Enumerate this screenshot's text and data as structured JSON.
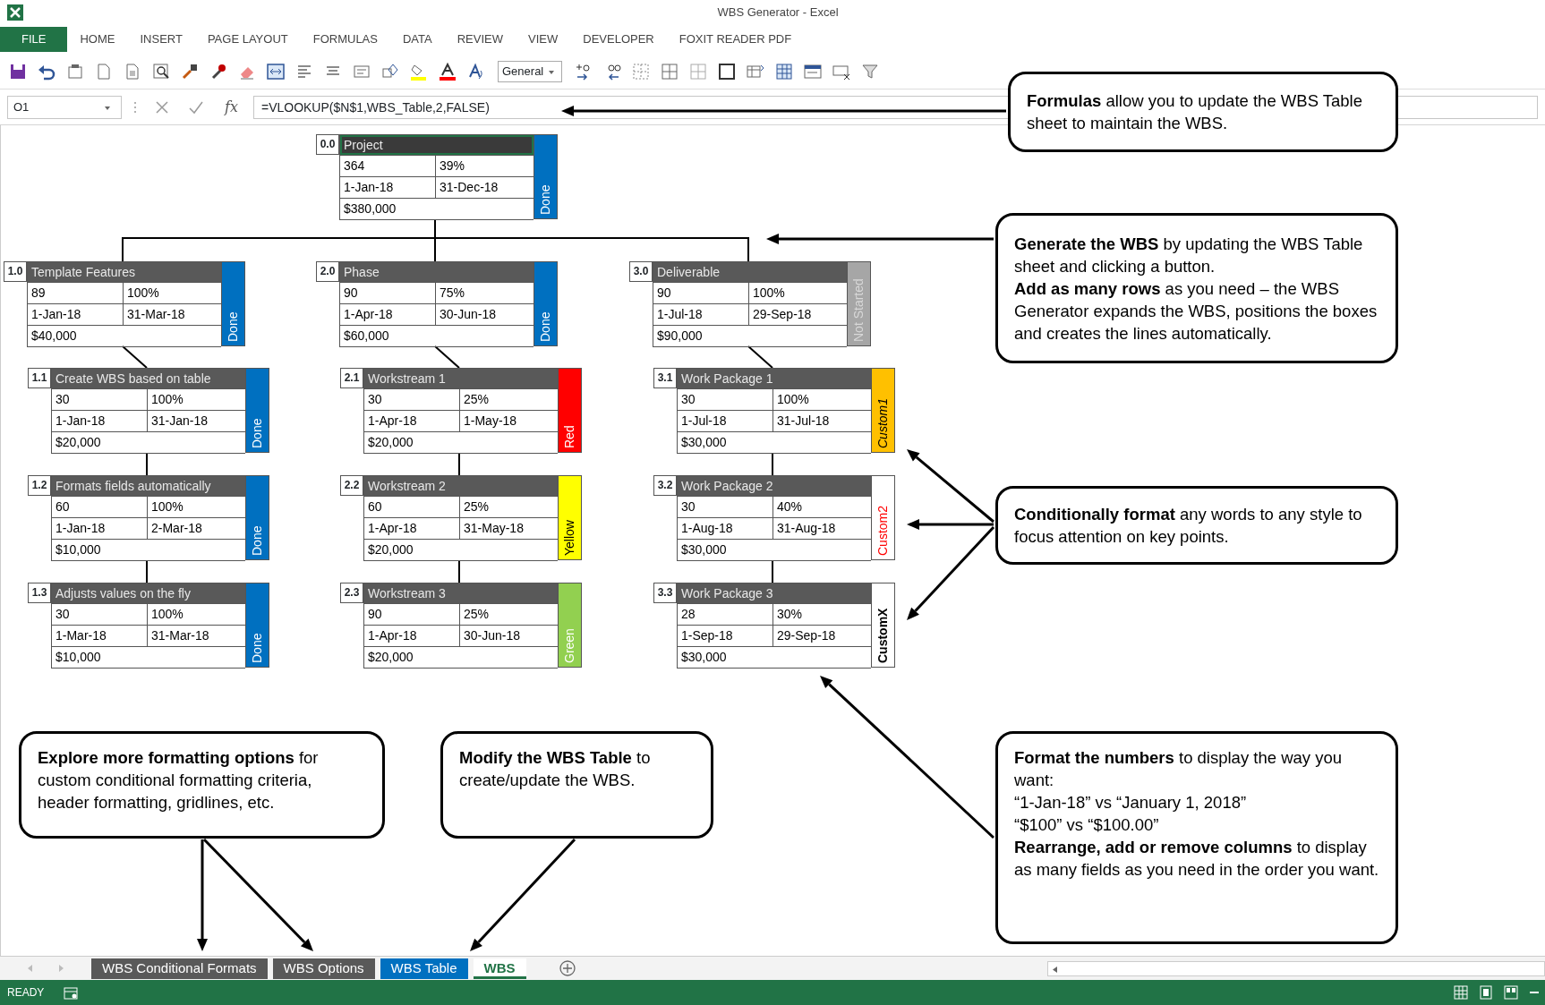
{
  "window": {
    "title": "WBS Generator - Excel"
  },
  "ribbon": {
    "file_tab": "FILE",
    "tabs": [
      "HOME",
      "INSERT",
      "PAGE LAYOUT",
      "FORMULAS",
      "DATA",
      "REVIEW",
      "VIEW",
      "DEVELOPER",
      "FOXIT READER PDF"
    ],
    "number_format": "General"
  },
  "formula_bar": {
    "name_box": "O1",
    "fx": "fx",
    "formula": "=VLOOKUP($N$1,WBS_Table,2,FALSE)"
  },
  "wbs": {
    "number": "0.0",
    "title": "Project",
    "selected": true,
    "duration": "364",
    "percent": "39%",
    "start": "1-Jan-18",
    "end": "31-Dec-18",
    "cost": "$380,000",
    "status": {
      "label": "Done",
      "color": "#0070c0",
      "kind": "light"
    },
    "children": [
      {
        "number": "1.0",
        "title": "Template Features",
        "selected": false,
        "duration": "89",
        "percent": "100%",
        "start": "1-Jan-18",
        "end": "31-Mar-18",
        "cost": "$40,000",
        "status": {
          "label": "Done",
          "color": "#0070c0",
          "kind": "light"
        },
        "children": [
          {
            "number": "1.1",
            "title": "Create WBS based on table",
            "selected": false,
            "duration": "30",
            "percent": "100%",
            "start": "1-Jan-18",
            "end": "31-Jan-18",
            "cost": "$20,000",
            "status": {
              "label": "Done",
              "color": "#0070c0",
              "kind": "light"
            }
          },
          {
            "number": "1.2",
            "title": "Formats fields automatically",
            "selected": false,
            "duration": "60",
            "percent": "100%",
            "start": "1-Jan-18",
            "end": "2-Mar-18",
            "cost": "$10,000",
            "status": {
              "label": "Done",
              "color": "#0070c0",
              "kind": "light"
            }
          },
          {
            "number": "1.3",
            "title": "Adjusts values on the fly",
            "selected": false,
            "duration": "30",
            "percent": "100%",
            "start": "1-Mar-18",
            "end": "31-Mar-18",
            "cost": "$10,000",
            "status": {
              "label": "Done",
              "color": "#0070c0",
              "kind": "light"
            }
          }
        ]
      },
      {
        "number": "2.0",
        "title": "Phase",
        "selected": false,
        "duration": "90",
        "percent": "75%",
        "start": "1-Apr-18",
        "end": "30-Jun-18",
        "cost": "$60,000",
        "status": {
          "label": "Done",
          "color": "#0070c0",
          "kind": "light"
        },
        "children": [
          {
            "number": "2.1",
            "title": "Workstream 1",
            "selected": false,
            "duration": "30",
            "percent": "25%",
            "start": "1-Apr-18",
            "end": "1-May-18",
            "cost": "$20,000",
            "status": {
              "label": "Red",
              "color": "#ff0000",
              "kind": "light"
            }
          },
          {
            "number": "2.2",
            "title": "Workstream 2",
            "selected": false,
            "duration": "60",
            "percent": "25%",
            "start": "1-Apr-18",
            "end": "31-May-18",
            "cost": "$20,000",
            "status": {
              "label": "Yellow",
              "color": "#ffff00",
              "kind": "dark"
            }
          },
          {
            "number": "2.3",
            "title": "Workstream 3",
            "selected": false,
            "duration": "90",
            "percent": "25%",
            "start": "1-Apr-18",
            "end": "30-Jun-18",
            "cost": "$20,000",
            "status": {
              "label": "Green",
              "color": "#92d050",
              "kind": "light"
            }
          }
        ]
      },
      {
        "number": "3.0",
        "title": "Deliverable",
        "selected": false,
        "duration": "90",
        "percent": "100%",
        "start": "1-Jul-18",
        "end": "29-Sep-18",
        "cost": "$90,000",
        "status": {
          "label": "Not Started",
          "color": "#a6a6a6",
          "kind": "muted"
        },
        "children": [
          {
            "number": "3.1",
            "title": "Work Package 1",
            "selected": false,
            "duration": "30",
            "percent": "100%",
            "start": "1-Jul-18",
            "end": "31-Jul-18",
            "cost": "$30,000",
            "status": {
              "label": "Custom1",
              "color": "#ffc000",
              "kind": "italic"
            }
          },
          {
            "number": "3.2",
            "title": "Work Package 2",
            "selected": false,
            "duration": "30",
            "percent": "40%",
            "start": "1-Aug-18",
            "end": "31-Aug-18",
            "cost": "$30,000",
            "status": {
              "label": "Custom2",
              "color": "#ffffff",
              "kind": "alert"
            }
          },
          {
            "number": "3.3",
            "title": "Work Package 3",
            "selected": false,
            "duration": "28",
            "percent": "30%",
            "start": "1-Sep-18",
            "end": "29-Sep-18",
            "cost": "$30,000",
            "status": {
              "label": "CustomX",
              "color": "#ffffff",
              "kind": "bold"
            }
          }
        ]
      }
    ]
  },
  "callouts": [
    {
      "paragraphs": [
        "**Formulas** allow you to update the WBS Table sheet to maintain the WBS."
      ]
    },
    {
      "paragraphs": [
        "**Generate the WBS** by updating the WBS Table sheet and clicking a button.",
        "**Add as many rows** as you need – the WBS Generator expands the WBS, positions the boxes and creates the lines automatically."
      ]
    },
    {
      "paragraphs": [
        "**Conditionally format** any words to any style to focus attention on key points."
      ]
    },
    {
      "paragraphs": [
        "**Explore more formatting options** for custom conditional formatting criteria, header formatting, gridlines, etc."
      ]
    },
    {
      "paragraphs": [
        "**Modify the WBS Table** to create/update the WBS."
      ]
    },
    {
      "paragraphs": [
        "**Format the numbers** to display the way you want:",
        "“1-Jan-18” vs “January 1, 2018”",
        "“$100” vs “$100.00”",
        "**Rearrange, add or remove columns** to display as many fields as you need in the order you want."
      ]
    }
  ],
  "sheet_tabs": [
    {
      "label": "WBS Conditional Formats",
      "color": "#595959",
      "selected": false
    },
    {
      "label": "WBS Options",
      "color": "#595959",
      "selected": false
    },
    {
      "label": "WBS Table",
      "color": "#0070c0",
      "selected": false
    },
    {
      "label": "WBS",
      "selected": true
    }
  ],
  "status_bar": {
    "text": "READY"
  }
}
